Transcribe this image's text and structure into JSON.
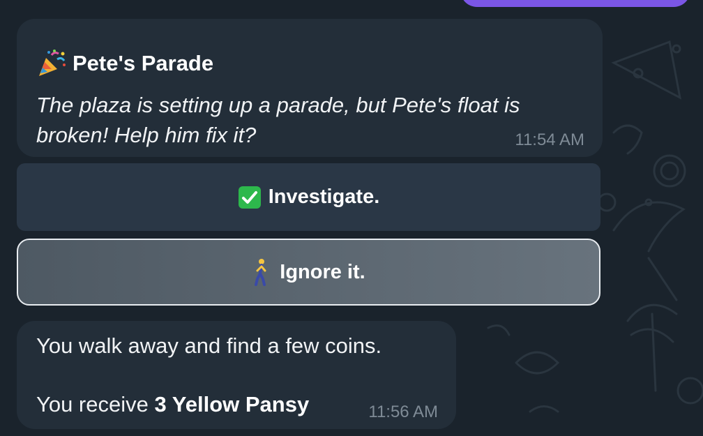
{
  "messages": [
    {
      "icon": "party-popper-icon",
      "title": "Pete's Parade",
      "story": "The plaza is setting up a parade, but Pete's float is broken! Help him fix it?",
      "time": "11:54 AM"
    },
    {
      "line1": "You walk away and find a few coins.",
      "receive_prefix": "You receive ",
      "receive_item": "3 Yellow Pansy",
      "time": "11:56 AM"
    }
  ],
  "choices": [
    {
      "icon": "check-mark-icon",
      "label": "Investigate."
    },
    {
      "icon": "walking-person-icon",
      "label": "Ignore it.",
      "selected": true
    }
  ],
  "colors": {
    "background": "#1a232c",
    "bubble": "#232e39",
    "choice": "#2a3746",
    "selected_choice_border": "#e9edf1",
    "outgoing_bubble": "#7b56e6",
    "check_green": "#2db84c",
    "timestamp": "#7f8b96"
  }
}
